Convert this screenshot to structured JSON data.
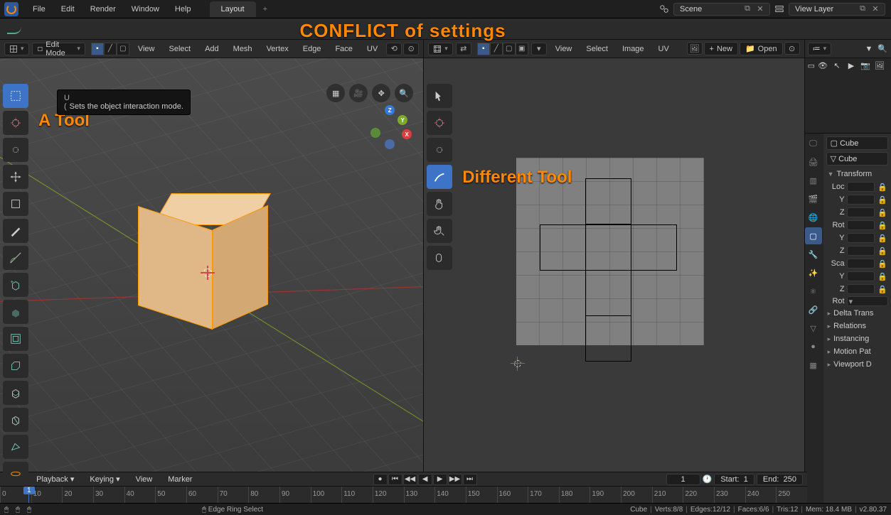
{
  "topbar": {
    "menus": [
      "File",
      "Edit",
      "Render",
      "Window",
      "Help"
    ],
    "workspace": "Layout",
    "scene_label": "Scene",
    "layer_label": "View Layer"
  },
  "annotations": {
    "conflict": "CONFLICT  of  settings",
    "tool_a": "A  Tool",
    "tool_b": "Different  Tool"
  },
  "viewport3d": {
    "mode_label": "Edit Mode",
    "menus": [
      "View",
      "Select",
      "Add",
      "Mesh",
      "Vertex",
      "Edge",
      "Face",
      "UV"
    ],
    "tooltip_prefix": "U",
    "tooltip_paren": "(",
    "tooltip": "Sets the object interaction mode.",
    "tools": [
      "select-box",
      "cursor",
      "move-origin",
      "move",
      "rotate",
      "scale",
      "transform",
      "annotate",
      "measure",
      "add-cube",
      "extrude-region",
      "inset",
      "bevel",
      "loop-cut",
      "knife",
      "poly-build"
    ]
  },
  "uv_editor": {
    "menus": [
      "View",
      "Select",
      "Image",
      "UV"
    ],
    "new_btn": "New",
    "open_btn": "Open",
    "tools": [
      "select-box",
      "cursor",
      "transform",
      "annotate",
      "grab",
      "pinch",
      "relax"
    ]
  },
  "outliner": {
    "collection": "",
    "object": "",
    "row_icons": [
      "eye",
      "cursor",
      "select",
      "camera",
      "render"
    ]
  },
  "properties": {
    "breadcrumb1": "Cube",
    "breadcrumb2": "Cube",
    "sections": {
      "transform": "Transform",
      "loc": "Loc",
      "rot": "Rot",
      "sca": "Sca",
      "axes": [
        "Y",
        "Z"
      ],
      "rot2": "Rot",
      "delta": "Delta Trans",
      "relations": "Relations",
      "instancing": "Instancing",
      "motion": "Motion Pat",
      "viewport": "Viewport D"
    },
    "tabs": [
      "render",
      "output",
      "view-layer",
      "scene",
      "world",
      "object",
      "modifier",
      "particles",
      "physics",
      "constraint",
      "data",
      "material",
      "texture"
    ]
  },
  "timeline": {
    "playback": "Playback",
    "keying": "Keying",
    "view": "View",
    "marker": "Marker",
    "current": "1",
    "start_label": "Start:",
    "start": "1",
    "end_label": "End:",
    "end": "250",
    "marks": [
      "0",
      "10",
      "20",
      "30",
      "40",
      "50",
      "60",
      "70",
      "80",
      "90",
      "100",
      "110",
      "120",
      "130",
      "140",
      "150",
      "160",
      "170",
      "180",
      "190",
      "200",
      "210",
      "220",
      "230",
      "240",
      "250"
    ]
  },
  "status": {
    "tool": "Edge Ring Select",
    "object": "Cube",
    "verts": "Verts:8/8",
    "edges": "Edges:12/12",
    "faces": "Faces:6/6",
    "tris": "Tris:12",
    "mem": "Mem: 18.4 MB",
    "version": "v2.80.37"
  }
}
